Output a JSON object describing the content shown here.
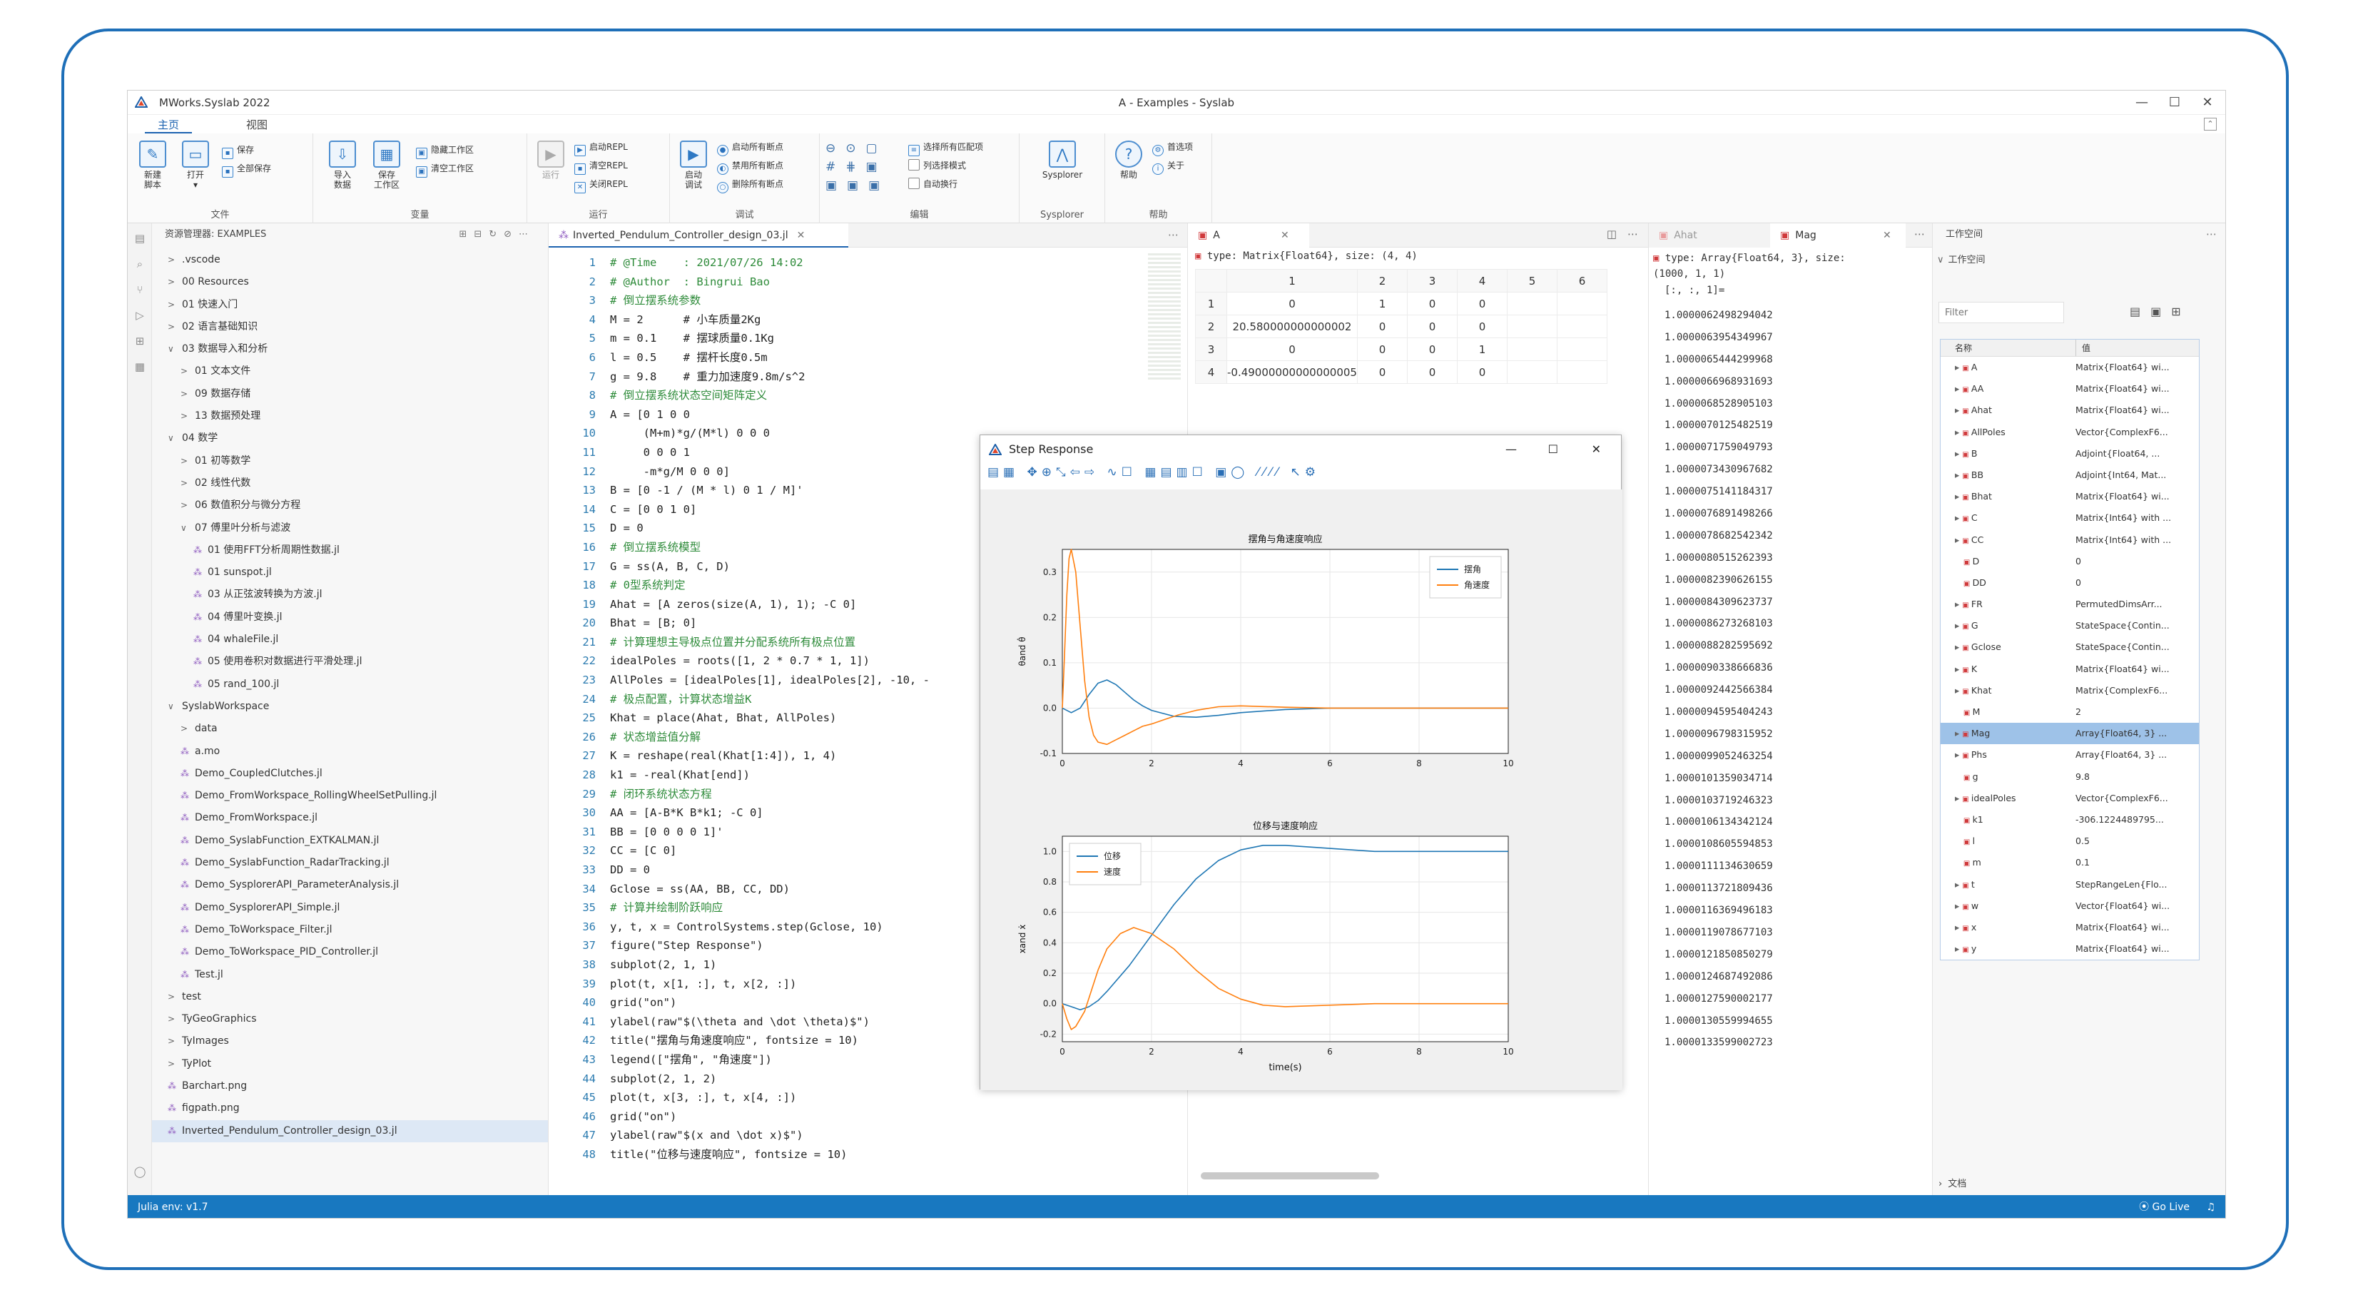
{
  "app": {
    "title": "MWorks.Syslab 2022",
    "window_title": "A - Examples - Syslab",
    "min_glyph": "—",
    "max_glyph": "☐",
    "close_glyph": "✕"
  },
  "menu_tabs": [
    "主页",
    "视图"
  ],
  "ribbon": {
    "groups": [
      {
        "label": "文件",
        "big": [
          {
            "label": "新建\n脚本",
            "icon": "new-script-icon"
          },
          {
            "label": "打开\n▾",
            "icon": "open-icon"
          }
        ],
        "small": [
          "保存",
          "全部保存"
        ]
      },
      {
        "label": "变量",
        "big": [
          {
            "label": "导入\n数据",
            "icon": "import-icon"
          },
          {
            "label": "保存\n工作区",
            "icon": "save-workspace-icon"
          }
        ],
        "small": [
          "隐藏工作区",
          "清空工作区"
        ]
      },
      {
        "label": "运行",
        "big": [
          {
            "label": "运行",
            "icon": "run-icon"
          }
        ],
        "small": [
          "启动REPL",
          "清空REPL",
          "关闭REPL"
        ]
      },
      {
        "label": "调试",
        "big": [
          {
            "label": "启动\n调试",
            "icon": "debug-icon"
          }
        ],
        "small": [
          "启动所有断点",
          "禁用所有断点",
          "删除所有断点"
        ]
      },
      {
        "label": "编辑",
        "big": [],
        "small": [
          "选择所有匹配项",
          "列选择模式",
          "自动换行"
        ]
      },
      {
        "label": "Sysplorer",
        "big": [
          {
            "label": "Sysplorer",
            "icon": "sysplorer-icon"
          }
        ],
        "small": []
      },
      {
        "label": "帮助",
        "big": [
          {
            "label": "帮助",
            "icon": "help-icon"
          }
        ],
        "small": [
          "首选项",
          "关于"
        ]
      }
    ]
  },
  "explorer": {
    "header": "资源管理器: EXAMPLES",
    "items": [
      {
        "indent": 1,
        "caret": ">",
        "label": ".vscode"
      },
      {
        "indent": 1,
        "caret": ">",
        "label": "00 Resources"
      },
      {
        "indent": 1,
        "caret": ">",
        "label": "01 快速入门"
      },
      {
        "indent": 1,
        "caret": ">",
        "label": "02 语言基础知识"
      },
      {
        "indent": 1,
        "caret": "∨",
        "label": "03 数据导入和分析"
      },
      {
        "indent": 2,
        "caret": ">",
        "label": "01 文本文件"
      },
      {
        "indent": 2,
        "caret": ">",
        "label": "09 数据存储"
      },
      {
        "indent": 2,
        "caret": ">",
        "label": "13 数据预处理"
      },
      {
        "indent": 1,
        "caret": "∨",
        "label": "04 数学"
      },
      {
        "indent": 2,
        "caret": ">",
        "label": "01 初等数学"
      },
      {
        "indent": 2,
        "caret": ">",
        "label": "02 线性代数"
      },
      {
        "indent": 2,
        "caret": ">",
        "label": "06 数值积分与微分方程"
      },
      {
        "indent": 2,
        "caret": "∨",
        "label": "07 傅里叶分析与滤波"
      },
      {
        "indent": 3,
        "caret": "",
        "label": "01 使用FFT分析周期性数据.jl",
        "file": true
      },
      {
        "indent": 3,
        "caret": "",
        "label": "01 sunspot.jl",
        "file": true
      },
      {
        "indent": 3,
        "caret": "",
        "label": "03 从正弦波转换为方波.jl",
        "file": true
      },
      {
        "indent": 3,
        "caret": "",
        "label": "04 傅里叶变换.jl",
        "file": true
      },
      {
        "indent": 3,
        "caret": "",
        "label": "04 whaleFile.jl",
        "file": true
      },
      {
        "indent": 3,
        "caret": "",
        "label": "05 使用卷积对数据进行平滑处理.jl",
        "file": true
      },
      {
        "indent": 3,
        "caret": "",
        "label": "05 rand_100.jl",
        "file": true
      },
      {
        "indent": 1,
        "caret": "∨",
        "label": "SyslabWorkspace"
      },
      {
        "indent": 2,
        "caret": ">",
        "label": "data"
      },
      {
        "indent": 2,
        "caret": "",
        "label": "a.mo",
        "file": true
      },
      {
        "indent": 2,
        "caret": "",
        "label": "Demo_CoupledClutches.jl",
        "file": true
      },
      {
        "indent": 2,
        "caret": "",
        "label": "Demo_FromWorkspace_RollingWheelSetPulling.jl",
        "file": true
      },
      {
        "indent": 2,
        "caret": "",
        "label": "Demo_FromWorkspace.jl",
        "file": true
      },
      {
        "indent": 2,
        "caret": "",
        "label": "Demo_SyslabFunction_EXTKALMAN.jl",
        "file": true
      },
      {
        "indent": 2,
        "caret": "",
        "label": "Demo_SyslabFunction_RadarTracking.jl",
        "file": true
      },
      {
        "indent": 2,
        "caret": "",
        "label": "Demo_SysplorerAPI_ParameterAnalysis.jl",
        "file": true
      },
      {
        "indent": 2,
        "caret": "",
        "label": "Demo_SysplorerAPI_Simple.jl",
        "file": true
      },
      {
        "indent": 2,
        "caret": "",
        "label": "Demo_ToWorkspace_Filter.jl",
        "file": true
      },
      {
        "indent": 2,
        "caret": "",
        "label": "Demo_ToWorkspace_PID_Controller.jl",
        "file": true
      },
      {
        "indent": 2,
        "caret": "",
        "label": "Test.jl",
        "file": true
      },
      {
        "indent": 1,
        "caret": ">",
        "label": "test"
      },
      {
        "indent": 1,
        "caret": ">",
        "label": "TyGeoGraphics"
      },
      {
        "indent": 1,
        "caret": ">",
        "label": "TyImages"
      },
      {
        "indent": 1,
        "caret": ">",
        "label": "TyPlot"
      },
      {
        "indent": 1,
        "caret": "",
        "label": "Barchart.png",
        "file": true
      },
      {
        "indent": 1,
        "caret": "",
        "label": "figpath.png",
        "file": true
      },
      {
        "indent": 1,
        "caret": "",
        "label": "Inverted_Pendulum_Controller_design_03.jl",
        "file": true,
        "selected": true
      }
    ]
  },
  "editor": {
    "tab": "Inverted_Pendulum_Controller_design_03.jl",
    "lines": [
      {
        "n": "1",
        "t": "# @Time    : 2021/07/26 14:02",
        "c": true
      },
      {
        "n": "2",
        "t": "# @Author  : Bingrui Bao",
        "c": true
      },
      {
        "n": "3",
        "t": "# 倒立摆系统参数",
        "c": true
      },
      {
        "n": "4",
        "t": "M = 2      # 小车质量2Kg"
      },
      {
        "n": "5",
        "t": "m = 0.1    # 摆球质量0.1Kg"
      },
      {
        "n": "6",
        "t": "l = 0.5    # 摆杆长度0.5m"
      },
      {
        "n": "7",
        "t": "g = 9.8    # 重力加速度9.8m/s^2"
      },
      {
        "n": "8",
        "t": "# 倒立摆系统状态空间矩阵定义",
        "c": true
      },
      {
        "n": "9",
        "t": "A = [0 1 0 0"
      },
      {
        "n": "10",
        "t": "     (M+m)*g/(M*l) 0 0 0"
      },
      {
        "n": "11",
        "t": "     0 0 0 1"
      },
      {
        "n": "12",
        "t": "     -m*g/M 0 0 0]"
      },
      {
        "n": "13",
        "t": "B = [0 -1 / (M * l) 0 1 / M]'"
      },
      {
        "n": "14",
        "t": "C = [0 0 1 0]"
      },
      {
        "n": "15",
        "t": "D = 0"
      },
      {
        "n": "16",
        "t": "# 倒立摆系统模型",
        "c": true
      },
      {
        "n": "17",
        "t": "G = ss(A, B, C, D)"
      },
      {
        "n": "18",
        "t": "# 0型系统判定",
        "c": true
      },
      {
        "n": "19",
        "t": "Ahat = [A zeros(size(A, 1), 1); -C 0]"
      },
      {
        "n": "20",
        "t": "Bhat = [B; 0]"
      },
      {
        "n": "21",
        "t": "# 计算理想主导极点位置并分配系统所有极点位置",
        "c": true
      },
      {
        "n": "22",
        "t": "idealPoles = roots([1, 2 * 0.7 * 1, 1])"
      },
      {
        "n": "23",
        "t": "AllPoles = [idealPoles[1], idealPoles[2], -10, -"
      },
      {
        "n": "24",
        "t": "# 极点配置，计算状态增益K",
        "c": true
      },
      {
        "n": "25",
        "t": "Khat = place(Ahat, Bhat, AllPoles)"
      },
      {
        "n": "26",
        "t": "# 状态增益值分解",
        "c": true
      },
      {
        "n": "27",
        "t": "K = reshape(real(Khat[1:4]), 1, 4)"
      },
      {
        "n": "28",
        "t": "k1 = -real(Khat[end])"
      },
      {
        "n": "29",
        "t": "# 闭环系统状态方程",
        "c": true
      },
      {
        "n": "30",
        "t": "AA = [A-B*K B*k1; -C 0]"
      },
      {
        "n": "31",
        "t": "BB = [0 0 0 0 1]'"
      },
      {
        "n": "32",
        "t": "CC = [C 0]"
      },
      {
        "n": "33",
        "t": "DD = 0"
      },
      {
        "n": "34",
        "t": "Gclose = ss(AA, BB, CC, DD)"
      },
      {
        "n": "35",
        "t": "# 计算并绘制阶跃响应",
        "c": true
      },
      {
        "n": "36",
        "t": "y, t, x = ControlSystems.step(Gclose, 10)"
      },
      {
        "n": "37",
        "t": "figure(\"Step Response\")"
      },
      {
        "n": "38",
        "t": "subplot(2, 1, 1)"
      },
      {
        "n": "39",
        "t": "plot(t, x[1, :], t, x[2, :])"
      },
      {
        "n": "40",
        "t": "grid(\"on\")"
      },
      {
        "n": "41",
        "t": "ylabel(raw\"$(\\theta and \\dot \\theta)$\")"
      },
      {
        "n": "42",
        "t": "title(\"摆角与角速度响应\", fontsize = 10)"
      },
      {
        "n": "43",
        "t": "legend([\"摆角\", \"角速度\"])"
      },
      {
        "n": "44",
        "t": "subplot(2, 1, 2)"
      },
      {
        "n": "45",
        "t": "plot(t, x[3, :], t, x[4, :])"
      },
      {
        "n": "46",
        "t": "grid(\"on\")"
      },
      {
        "n": "47",
        "t": "ylabel(raw\"$(x and \\dot x)$\")"
      },
      {
        "n": "48",
        "t": "title(\"位移与速度响应\", fontsize = 10)"
      }
    ]
  },
  "var_a": {
    "tab": "A",
    "type_line": "type: Matrix{Float64}, size: (4, 4)",
    "cols": [
      "1",
      "2",
      "3",
      "4",
      "5",
      "6"
    ],
    "rows": [
      {
        "i": "1",
        "cells": [
          "0",
          "1",
          "0",
          "0"
        ]
      },
      {
        "i": "2",
        "cells": [
          "20.580000000000002",
          "0",
          "0",
          "0"
        ]
      },
      {
        "i": "3",
        "cells": [
          "0",
          "0",
          "0",
          "1"
        ]
      },
      {
        "i": "4",
        "cells": [
          "-0.49000000000000005",
          "0",
          "0",
          "0"
        ]
      }
    ]
  },
  "var_mag": {
    "tabs": [
      "Ahat",
      "Mag"
    ],
    "type_line": "type: Array{Float64, 3}, size:\n(1000, 1, 1)",
    "slice": "[:, :, 1]=",
    "values": [
      "1.0000062498294042",
      "1.0000063954349967",
      "1.0000065444299968",
      "1.0000066968931693",
      "1.0000068528905103",
      "1.0000070125482519",
      "1.0000071759049793",
      "1.0000073430967682",
      "1.0000075141184317",
      "1.0000076891498266",
      "1.0000078682542342",
      "1.0000080515262393",
      "1.0000082390626155",
      "1.0000084309623737",
      "1.0000086273268103",
      "1.0000088282595692",
      "1.0000090338666836",
      "1.0000092442566384",
      "1.0000094595404243",
      "1.0000096798315952",
      "1.0000099052463254",
      "1.0000101359034714",
      "1.0000103719246323",
      "1.0000106134342124",
      "1.0000108605594853",
      "1.0000111134630659",
      "1.0000113721809436",
      "1.0000116369496183",
      "1.0000119078677103",
      "1.0000121850850279",
      "1.0000124687492086",
      "1.0000127590002177",
      "1.0000130559994655",
      "1.0000133599002723"
    ]
  },
  "workspace": {
    "title": "工作空间",
    "section": "工作空间",
    "filter_placeholder": "Filter",
    "col_name": "名称",
    "col_value": "值",
    "vars": [
      {
        "n": "A",
        "v": "Matrix{Float64} wi...",
        "c": true
      },
      {
        "n": "AA",
        "v": "Matrix{Float64} wi...",
        "c": true
      },
      {
        "n": "Ahat",
        "v": "Matrix{Float64} wi...",
        "c": true
      },
      {
        "n": "AllPoles",
        "v": "Vector{ComplexF6...",
        "c": true
      },
      {
        "n": "B",
        "v": "Adjoint{Float64, ...",
        "c": true
      },
      {
        "n": "BB",
        "v": "Adjoint{Int64, Mat...",
        "c": true
      },
      {
        "n": "Bhat",
        "v": "Matrix{Float64} wi...",
        "c": true
      },
      {
        "n": "C",
        "v": "Matrix{Int64} with ...",
        "c": true
      },
      {
        "n": "CC",
        "v": "Matrix{Int64} with ...",
        "c": true
      },
      {
        "n": "D",
        "v": "0",
        "c": false
      },
      {
        "n": "DD",
        "v": "0",
        "c": false
      },
      {
        "n": "FR",
        "v": "PermutedDimsArr...",
        "c": true
      },
      {
        "n": "G",
        "v": "StateSpace{Contin...",
        "c": true
      },
      {
        "n": "Gclose",
        "v": "StateSpace{Contin...",
        "c": true
      },
      {
        "n": "K",
        "v": "Matrix{Float64} wi...",
        "c": true
      },
      {
        "n": "Khat",
        "v": "Matrix{ComplexF6...",
        "c": true
      },
      {
        "n": "M",
        "v": "2",
        "c": false
      },
      {
        "n": "Mag",
        "v": "Array{Float64, 3} ...",
        "c": true,
        "sel": true
      },
      {
        "n": "Phs",
        "v": "Array{Float64, 3} ...",
        "c": true
      },
      {
        "n": "g",
        "v": "9.8",
        "c": false
      },
      {
        "n": "idealPoles",
        "v": "Vector{ComplexF6...",
        "c": true
      },
      {
        "n": "k1",
        "v": "-306.1224489795...",
        "c": false
      },
      {
        "n": "l",
        "v": "0.5",
        "c": false
      },
      {
        "n": "m",
        "v": "0.1",
        "c": false
      },
      {
        "n": "t",
        "v": "StepRangeLen{Flo...",
        "c": true
      },
      {
        "n": "w",
        "v": "Vector{Float64} wi...",
        "c": true
      },
      {
        "n": "x",
        "v": "Matrix{Float64} wi...",
        "c": true
      },
      {
        "n": "y",
        "v": "Matrix{Float64} wi...",
        "c": true
      }
    ],
    "docs": "文档"
  },
  "status": {
    "left": "Julia env: v1.7",
    "right": "Go Live"
  },
  "figure": {
    "title": "Step Response",
    "toolbar": "▤▦ ✥⊕⤡⇦⇨ ∿☐ ▦▤▥☐ ▣◯ ⁄⁄⁄⁄ ↖⚙"
  },
  "chart_data": [
    {
      "type": "line",
      "title": "摆角与角速度响应",
      "xlabel": "",
      "ylabel": "θand θ̇",
      "xlim": [
        0,
        10
      ],
      "ylim": [
        -0.1,
        0.35
      ],
      "xticks": [
        0,
        2,
        4,
        6,
        8,
        10
      ],
      "yticks": [
        -0.1,
        0.0,
        0.1,
        0.2,
        0.3
      ],
      "ytick_labels": [
        "-0.1",
        "0.0",
        "0.1",
        "0.2",
        "0.3"
      ],
      "grid": true,
      "legend": "top-right",
      "series": [
        {
          "name": "摆角",
          "color": "#1f77b4",
          "x": [
            0,
            0.2,
            0.4,
            0.6,
            0.8,
            1.0,
            1.2,
            1.4,
            1.6,
            1.8,
            2,
            2.5,
            3,
            3.5,
            4,
            5,
            6,
            7,
            8,
            10
          ],
          "y": [
            0,
            -0.01,
            0.0,
            0.03,
            0.055,
            0.062,
            0.052,
            0.035,
            0.018,
            0.005,
            -0.005,
            -0.018,
            -0.02,
            -0.016,
            -0.01,
            -0.003,
            0,
            0,
            0,
            0
          ]
        },
        {
          "name": "角速度",
          "color": "#ff7f0e",
          "x": [
            0,
            0.05,
            0.1,
            0.15,
            0.2,
            0.3,
            0.4,
            0.5,
            0.6,
            0.7,
            0.8,
            1.0,
            1.2,
            1.4,
            1.6,
            1.8,
            2.0,
            2.3,
            2.6,
            3.0,
            3.5,
            4,
            5,
            6,
            7,
            8,
            10
          ],
          "y": [
            0,
            0.12,
            0.25,
            0.33,
            0.35,
            0.3,
            0.18,
            0.06,
            -0.02,
            -0.06,
            -0.075,
            -0.08,
            -0.07,
            -0.06,
            -0.05,
            -0.04,
            -0.035,
            -0.025,
            -0.015,
            -0.005,
            0.003,
            0.005,
            0.002,
            0,
            0,
            0,
            0
          ]
        }
      ]
    },
    {
      "type": "line",
      "title": "位移与速度响应",
      "xlabel": "time(s)",
      "ylabel": "xand ẋ",
      "xlim": [
        0,
        10
      ],
      "ylim": [
        -0.25,
        1.1
      ],
      "xticks": [
        0,
        2,
        4,
        6,
        8,
        10
      ],
      "yticks": [
        -0.2,
        0.0,
        0.2,
        0.4,
        0.6,
        0.8,
        1.0
      ],
      "ytick_labels": [
        "-0.2",
        "0.0",
        "0.2",
        "0.4",
        "0.6",
        "0.8",
        "1.0"
      ],
      "grid": true,
      "legend": "top-left",
      "series": [
        {
          "name": "位移",
          "color": "#1f77b4",
          "x": [
            0,
            0.2,
            0.4,
            0.6,
            0.8,
            1.0,
            1.5,
            2,
            2.5,
            3,
            3.5,
            4,
            4.5,
            5,
            6,
            7,
            8,
            9,
            10
          ],
          "y": [
            0,
            -0.02,
            -0.04,
            -0.02,
            0.02,
            0.08,
            0.25,
            0.45,
            0.65,
            0.82,
            0.94,
            1.01,
            1.04,
            1.04,
            1.02,
            1.0,
            1.0,
            1.0,
            1.0
          ]
        },
        {
          "name": "速度",
          "color": "#ff7f0e",
          "x": [
            0,
            0.1,
            0.2,
            0.3,
            0.5,
            0.8,
            1.0,
            1.3,
            1.6,
            2,
            2.5,
            3,
            3.5,
            4,
            4.5,
            5,
            6,
            7,
            8,
            10
          ],
          "y": [
            0,
            -0.1,
            -0.17,
            -0.15,
            -0.05,
            0.22,
            0.36,
            0.46,
            0.5,
            0.46,
            0.36,
            0.22,
            0.1,
            0.03,
            -0.01,
            -0.02,
            -0.01,
            0,
            0,
            0
          ]
        }
      ]
    }
  ]
}
